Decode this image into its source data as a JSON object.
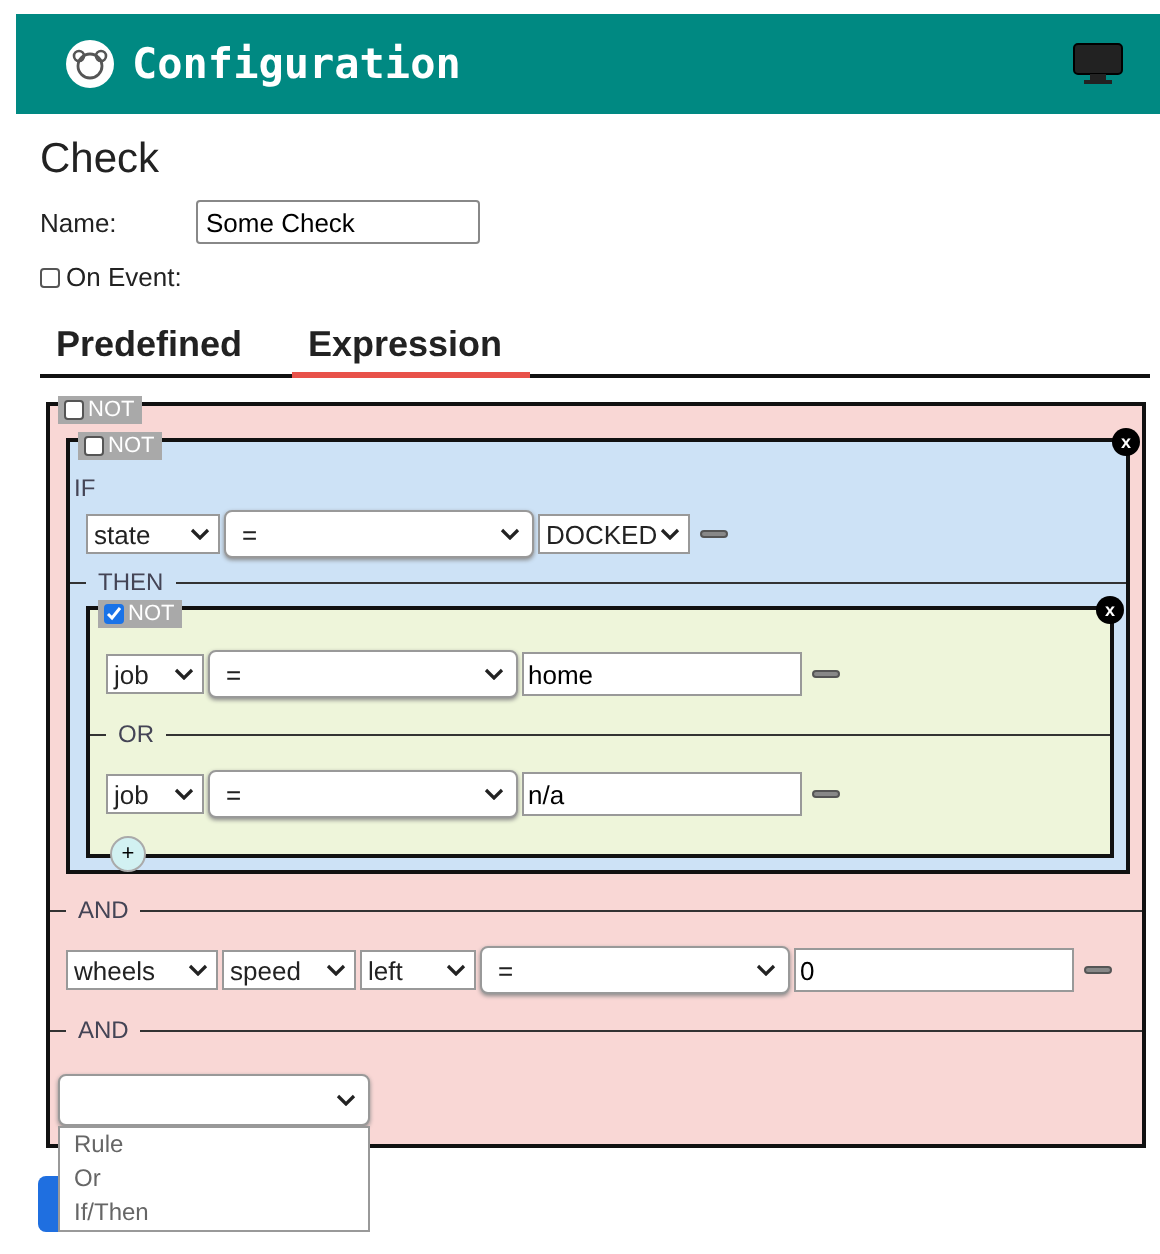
{
  "header": {
    "title": "Configuration"
  },
  "heading": "Check",
  "name_field": {
    "label": "Name:",
    "value": "Some Check"
  },
  "on_event": {
    "label": "On Event:",
    "checked": false
  },
  "tabs": [
    {
      "label": "Predefined",
      "selected": false
    },
    {
      "label": "Expression",
      "selected": true
    }
  ],
  "expression": {
    "kind": "group",
    "color": "#f9d7d5",
    "not_label": "NOT",
    "not": false,
    "items": [
      {
        "kind": "ifthen",
        "color": "#cde2f6",
        "not_label": "NOT",
        "not": false,
        "close_label": "x",
        "if_label": "IF",
        "condition": {
          "kind": "rule",
          "fields": [
            {
              "kind": "select",
              "value": "state"
            },
            {
              "kind": "operator",
              "value": "="
            },
            {
              "kind": "select",
              "value": "DOCKED"
            }
          ]
        },
        "then_label": "THEN",
        "then": {
          "kind": "group",
          "color": "#eef5da",
          "not_label": "NOT",
          "not": true,
          "close_label": "x",
          "add_label": "+",
          "items": [
            {
              "kind": "rule",
              "fields": [
                {
                  "kind": "select",
                  "value": "job"
                },
                {
                  "kind": "operator",
                  "value": "="
                },
                {
                  "kind": "input",
                  "value": "home"
                }
              ]
            },
            {
              "kind": "separator",
              "label": "OR"
            },
            {
              "kind": "rule",
              "fields": [
                {
                  "kind": "select",
                  "value": "job"
                },
                {
                  "kind": "operator",
                  "value": "="
                },
                {
                  "kind": "input",
                  "value": "n/a"
                }
              ]
            }
          ]
        }
      },
      {
        "kind": "separator",
        "label": "AND"
      },
      {
        "kind": "rule",
        "fields": [
          {
            "kind": "select",
            "value": "wheels"
          },
          {
            "kind": "select",
            "value": "speed"
          },
          {
            "kind": "select",
            "value": "left"
          },
          {
            "kind": "operator",
            "value": "="
          },
          {
            "kind": "input",
            "value": "0"
          }
        ]
      },
      {
        "kind": "separator",
        "label": "AND"
      },
      {
        "kind": "add_select",
        "open": true,
        "options": [
          "Rule",
          "Or",
          "If/Then"
        ]
      }
    ]
  }
}
